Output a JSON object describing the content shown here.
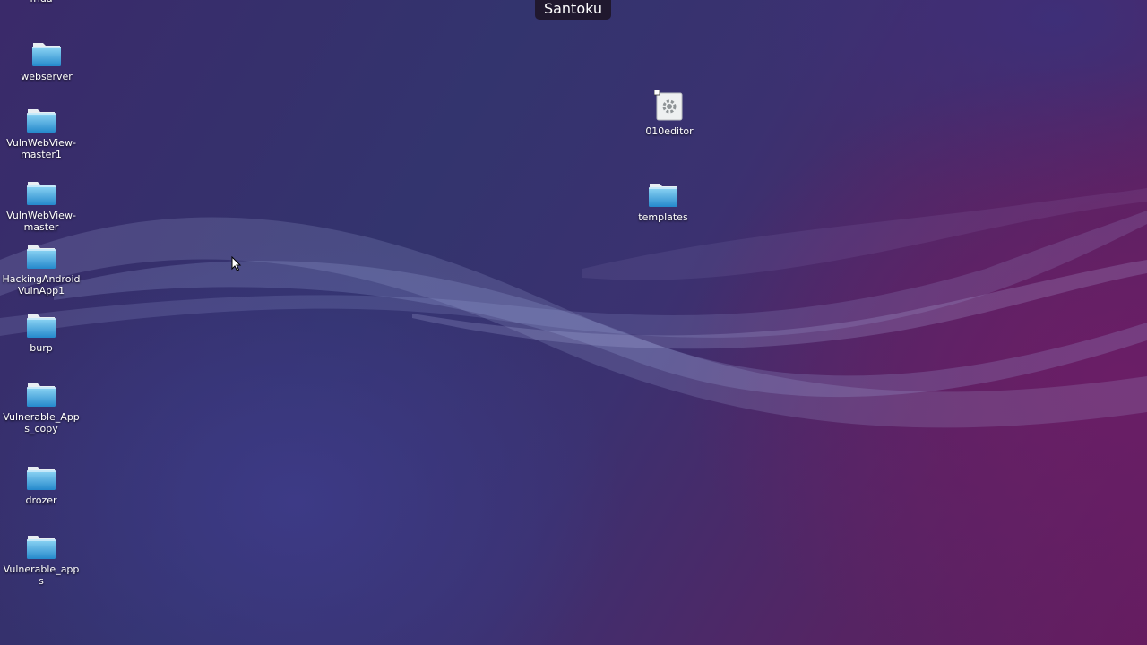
{
  "topbar": {
    "title": "Santoku"
  },
  "desktop_icons": [
    {
      "label": "frida",
      "icon": "folder-icon"
    },
    {
      "label": "webserver",
      "icon": "folder-icon"
    },
    {
      "label": "VulnWebView-master1",
      "icon": "folder-icon"
    },
    {
      "label": "VulnWebView-master",
      "icon": "folder-icon"
    },
    {
      "label": "HackingAndroidVulnApp1",
      "icon": "folder-icon"
    },
    {
      "label": "burp",
      "icon": "folder-icon"
    },
    {
      "label": "Vulnerable_Apps_copy",
      "icon": "folder-icon"
    },
    {
      "label": "drozer",
      "icon": "folder-icon"
    },
    {
      "label": "Vulnerable_apps",
      "icon": "folder-icon"
    },
    {
      "label": "010editor",
      "icon": "executable-gear-icon"
    },
    {
      "label": "templates",
      "icon": "folder-icon"
    }
  ],
  "colors": {
    "folder_top": "#7fcdf0",
    "folder_bottom": "#2a93d4",
    "topbar_bg": "#1e1628"
  }
}
